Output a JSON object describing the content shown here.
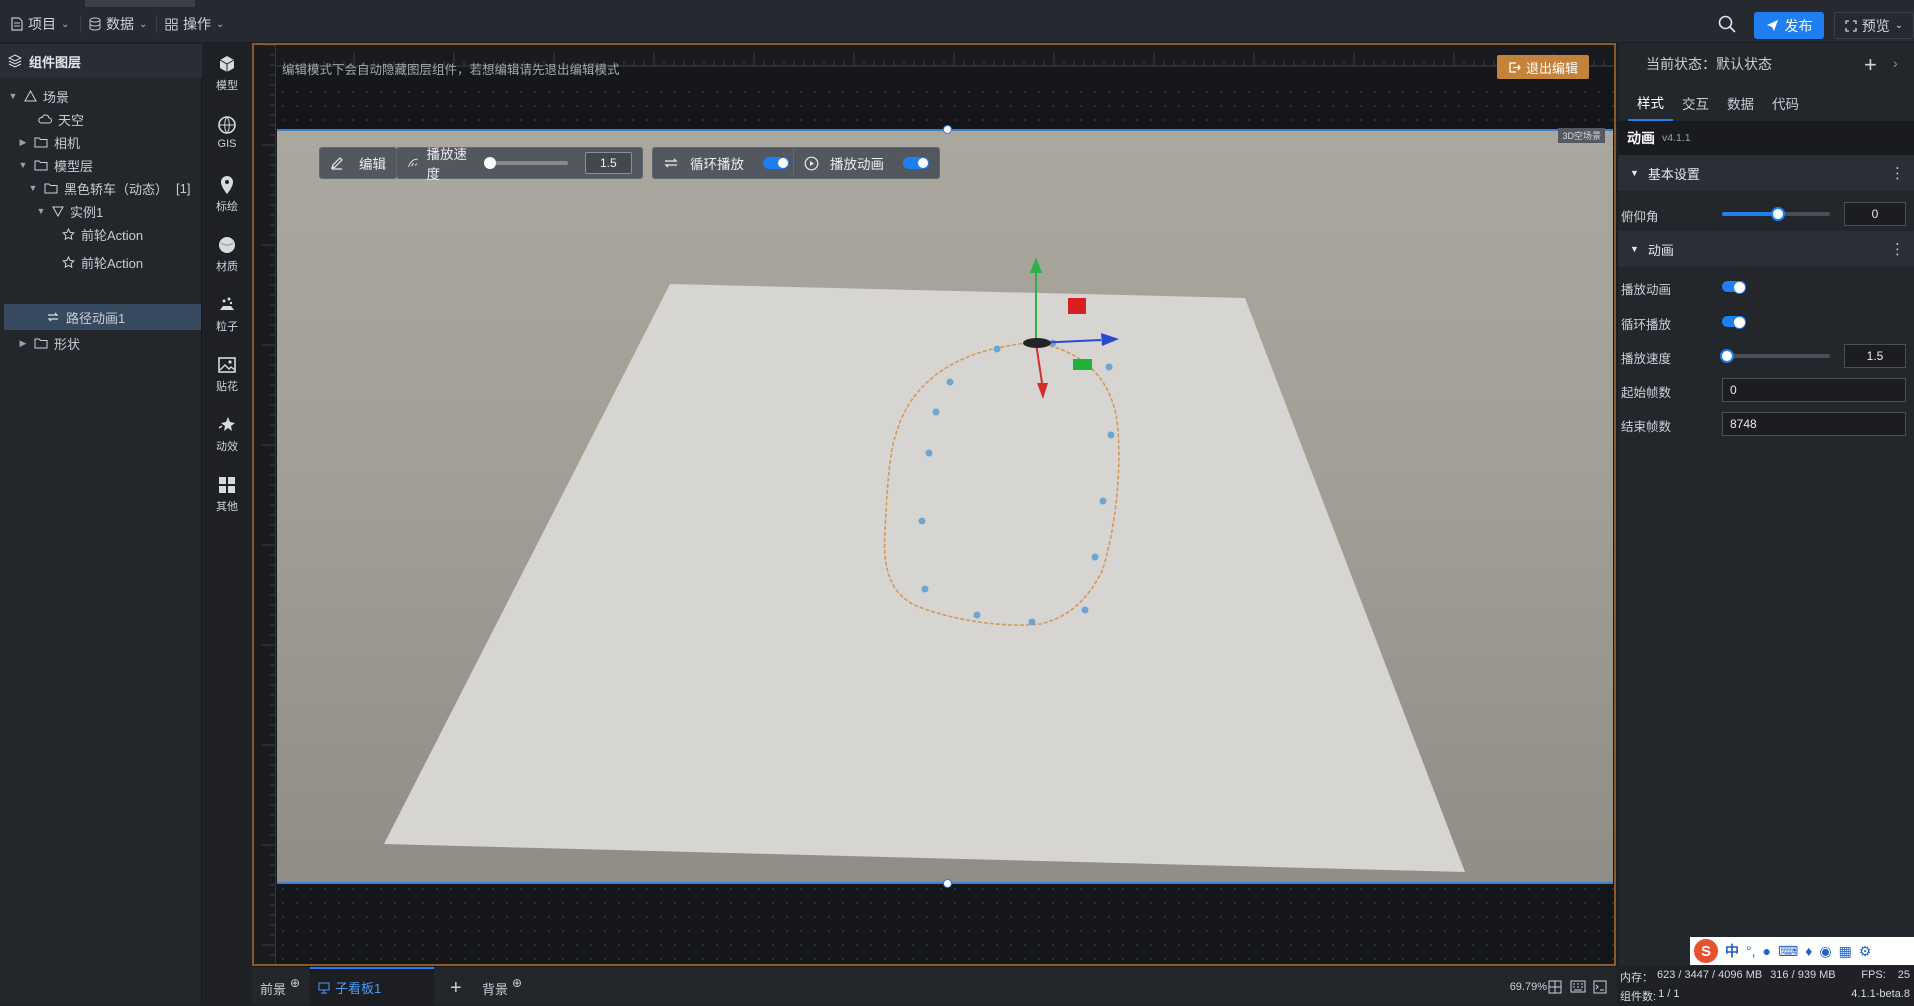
{
  "topbar": {
    "menus": [
      {
        "label": "项目"
      },
      {
        "label": "数据"
      },
      {
        "label": "操作"
      }
    ],
    "publish_label": "发布",
    "preview_label": "预览"
  },
  "layers": {
    "title": "组件图层",
    "nodes": [
      {
        "label": "场景"
      },
      {
        "label": "天空"
      },
      {
        "label": "相机"
      },
      {
        "label": "模型层"
      },
      {
        "label": "黑色轿车（动态）"
      },
      {
        "label": "实例1"
      },
      {
        "label": "前轮Action"
      },
      {
        "label": "前轮Action"
      },
      {
        "label": "路径动画1"
      },
      {
        "label": "形状"
      }
    ],
    "node4_badge": "[1]"
  },
  "tools": [
    {
      "label": "模型",
      "icon": "model-icon"
    },
    {
      "label": "GIS",
      "icon": "globe-icon"
    },
    {
      "label": "标绘",
      "icon": "pin-icon"
    },
    {
      "label": "材质",
      "icon": "material-icon"
    },
    {
      "label": "粒子",
      "icon": "particle-icon"
    },
    {
      "label": "贴花",
      "icon": "decal-icon"
    },
    {
      "label": "动效",
      "icon": "effect-icon"
    },
    {
      "label": "其他",
      "icon": "grid-icon"
    }
  ],
  "viewport": {
    "notice": "编辑模式下会自动隐藏图层组件，若想编辑请先退出编辑模式",
    "exit_edit_label": "退出编辑",
    "scene_label": "3D空场景",
    "toolbar": {
      "edit_label": "编辑",
      "speed_label": "播放速度",
      "speed_value": "1.5",
      "loop_label": "循环播放",
      "play_label": "播放动画"
    }
  },
  "inspector": {
    "state_label": "当前状态：",
    "state_value": "默认状态",
    "tabs": [
      {
        "label": "样式"
      },
      {
        "label": "交互"
      },
      {
        "label": "数据"
      },
      {
        "label": "代码"
      }
    ],
    "component_title": "动画",
    "component_version": "v4.1.1",
    "section_basic": "基本设置",
    "pitch_label": "俯仰角",
    "pitch_value": "0",
    "section_anim": "动画",
    "play_anim_label": "播放动画",
    "loop_label": "循环播放",
    "speed_label": "播放速度",
    "speed_value": "1.5",
    "start_frame_label": "起始帧数",
    "start_frame_value": "0",
    "end_frame_label": "结束帧数",
    "end_frame_value": "8748"
  },
  "bottombar": {
    "tab_front": "前景",
    "tab_sub": "子看板1",
    "tab_bg": "背景",
    "zoom": "69.79%"
  },
  "status": {
    "memory_label": "内存：",
    "memory_value": "623 / 3447 / 4096 MB",
    "gpu_value": "316 / 939 MB",
    "fps_label": "FPS:",
    "fps_value": "25",
    "count_label": "组件数:",
    "count_value": "1 / 1",
    "version": "4.1.1-beta.8"
  },
  "ime": {
    "label": "中"
  },
  "colors": {
    "accent": "#1f7ff0",
    "exit_button": "#c5823b",
    "viewport_border": "#8a5a2c"
  }
}
